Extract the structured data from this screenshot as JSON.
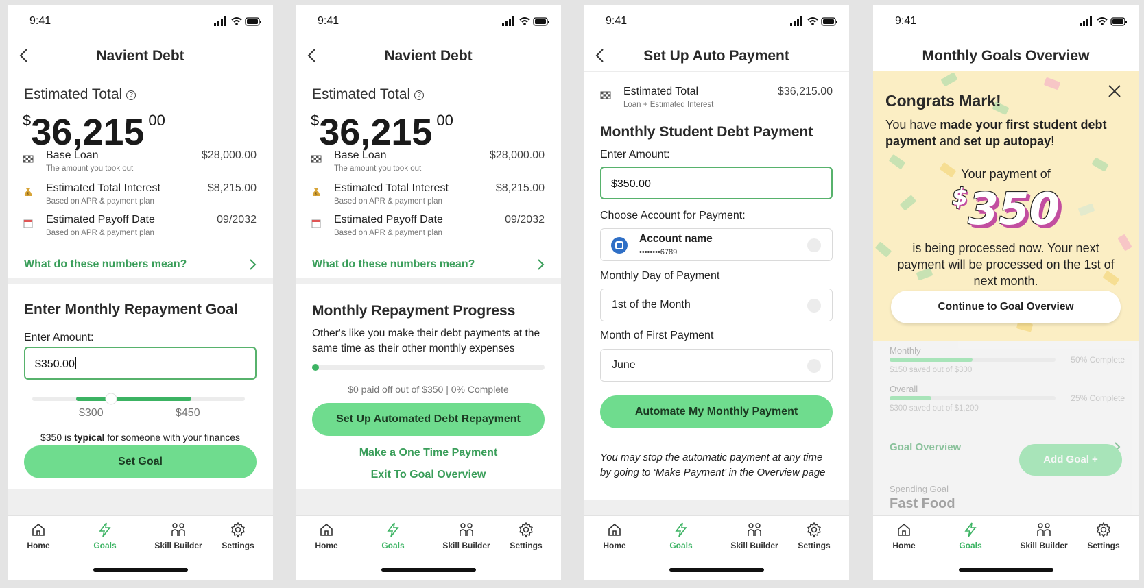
{
  "status": {
    "time": "9:41"
  },
  "tabs": [
    {
      "icon": "home-icon",
      "label": "Home"
    },
    {
      "icon": "lightning-icon",
      "label": "Goals"
    },
    {
      "icon": "people-icon",
      "label": "Skill Builder"
    },
    {
      "icon": "gear-icon",
      "label": "Settings"
    }
  ],
  "screen1": {
    "title": "Navient Debt",
    "estimated_total_label": "Estimated Total",
    "help": "?",
    "amount_currency": "$",
    "amount_main": "36,215",
    "amount_cents": "00",
    "rows": [
      {
        "label": "Base Loan",
        "sub": "The amount you took out",
        "value": "$28,000.00"
      },
      {
        "label": "Estimated Total Interest",
        "sub": "Based on APR & payment plan",
        "value": "$8,215.00"
      },
      {
        "label": "Estimated Payoff Date",
        "sub": "Based on APR & payment plan",
        "value": "09/2032"
      }
    ],
    "link": "What do these numbers mean?",
    "goal_heading": "Enter Monthly Repayment Goal",
    "enter_amount": "Enter Amount:",
    "input_value": "$350.00",
    "slider_min_label": "$300",
    "slider_max_label": "$450",
    "typical_pre": "$350 is ",
    "typical_bold": "typical",
    "typical_post": " for someone with your finances",
    "set_goal": "Set Goal"
  },
  "screen2": {
    "title": "Navient Debt",
    "progress_heading": "Monthly Repayment Progress",
    "progress_desc": "Other's like you make their debt payments at the same time as their other monthly expenses",
    "progress_fraction": 0,
    "progress_text": "$0 paid off out of $350 | 0% Complete",
    "auto_button": "Set Up Automated Debt Repayment",
    "one_time": "Make a One Time Payment",
    "exit": "Exit To Goal Overview"
  },
  "screen3": {
    "title": "Set Up Auto Payment",
    "est_label": "Estimated Total",
    "est_sub": "Loan + Estimated Interest",
    "est_value": "$36,215.00",
    "heading": "Monthly Student Debt Payment",
    "enter_amount": "Enter Amount:",
    "input_value": "$350.00",
    "choose_account": "Choose Account for Payment:",
    "account_name": "Account name",
    "account_number": "••••••••6789",
    "day_label": "Monthly Day of Payment",
    "day_value": "1st of the Month",
    "month_label": "Month of First Payment",
    "month_value": "June",
    "automate_button": "Automate My Monthly Payment",
    "note": "You may stop the automatic payment at any time by going to ‘Make Payment’ in the Overview page"
  },
  "screen4": {
    "title": "Monthly Goals Overview",
    "congrats": "Congrats Mark!",
    "msg_1": "You have ",
    "msg_bold1": "made your first student debt payment",
    "msg_2": " and ",
    "msg_bold2": "set up autopay",
    "msg_3": "!",
    "your_payment": "Your payment of",
    "big_currency": "$",
    "big_amount": "350",
    "processing": "is being processed now. Your next payment will be processed on the 1st of next month.",
    "continue_button": "Continue to Goal Overview",
    "monthly_label": "Monthly",
    "monthly_sub": "$150 saved out of $300",
    "monthly_pct": "50% Complete",
    "monthly_fraction": 0.5,
    "overall_label": "Overall",
    "overall_sub": "$300 saved out of $1,200",
    "overall_pct": "25% Complete",
    "overall_fraction": 0.25,
    "goal_overview": "Goal Overview",
    "add_goal": "Add Goal +",
    "spending_goal": "Spending Goal",
    "fast_food": "Fast Food"
  },
  "colors": {
    "accent": "#6fdc8e",
    "link": "#3a9e5a",
    "banner": "#fbeec4",
    "amount_purple": "#c24ea0"
  }
}
